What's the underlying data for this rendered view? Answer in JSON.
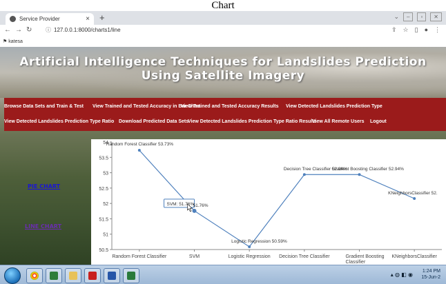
{
  "caption": "Chart",
  "browser": {
    "tab_title": "Service Provider",
    "tab_close": "×",
    "new_tab": "+",
    "url": "127.0.0.1:8000/charts1/line",
    "bookmark": "katesa"
  },
  "site": {
    "title": "Artificial Intelligence Techniques for Landslides Prediction Using Satellite Imagery",
    "menu": [
      "Browse Data Sets and Train & Test",
      "View Trained and Tested Accuracy in Bar Chart",
      "View Trained and Tested Accuracy Results",
      "View Detected Landslides Prediction Type",
      "View Detected Landslides Prediction Type Ratio",
      "Download Predicted Data Sets",
      "View Detected Landslides Prediction Type Ratio Results",
      "View All Remote Users",
      "Logout"
    ],
    "sidebar": {
      "pie_chart": "PIE CHART",
      "line_chart": "LINE CHART"
    }
  },
  "chart_data": {
    "type": "line",
    "categories": [
      "Random Forest Classifier",
      "SVM",
      "Logistic Regression",
      "Decision Tree Classifier",
      "Gradient Boosting Classifier",
      "KNeighborsClassifier"
    ],
    "values": [
      53.73,
      51.76,
      50.59,
      52.94,
      52.94,
      52.16
    ],
    "data_labels": [
      "Random Forest Classifier 53.73%",
      "SVM: 51.76%",
      "Logistic Regression 50.59%",
      "Decision Tree Classifier 52.94%",
      "Gradient Boosting Classifier 52.94%",
      "KNeighborsClassifier 52."
    ],
    "yticks": [
      "54",
      "53.5",
      "53",
      "52.5",
      "52",
      "51.5",
      "51",
      "50.5"
    ],
    "ylim": [
      50.5,
      54
    ],
    "tooltip": "SVM: 51.76%",
    "tooltip_value": "51.76%",
    "line_color": "#4f81bd"
  },
  "taskbar": {
    "time": "1:24 PM",
    "date": "15-Jun-2"
  }
}
